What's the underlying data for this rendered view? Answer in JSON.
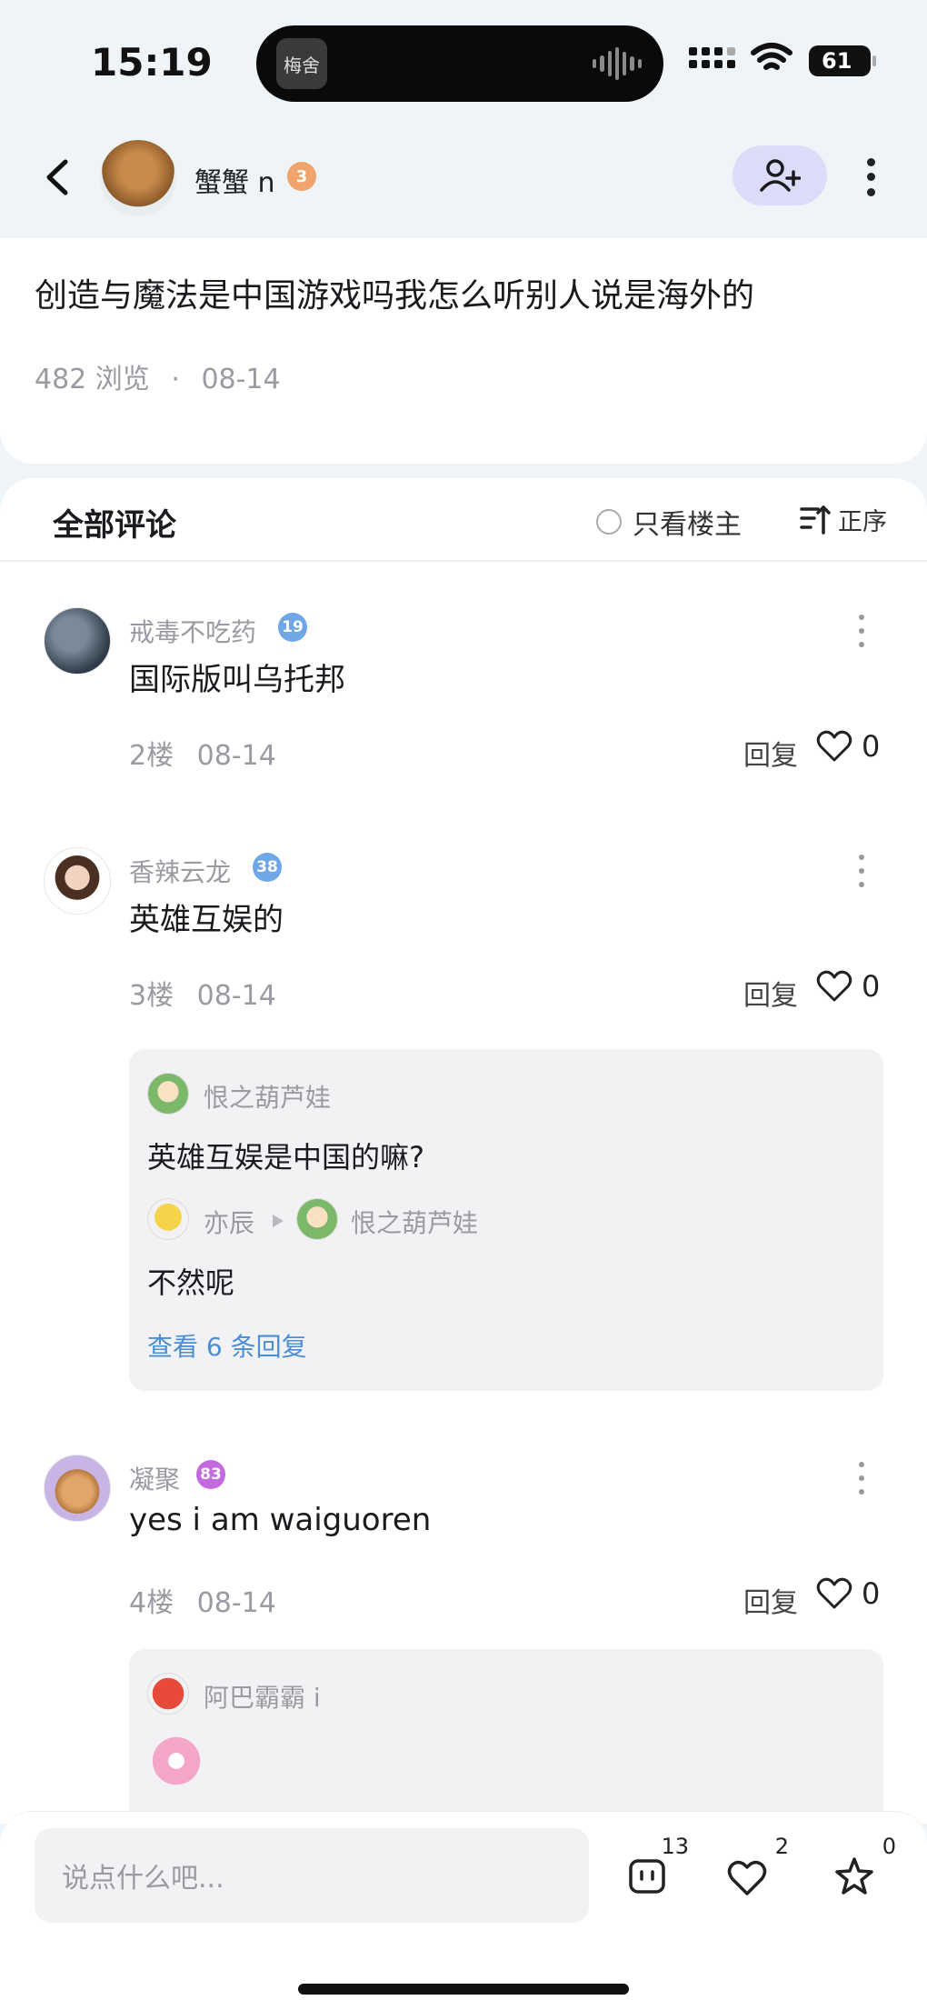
{
  "status_bar": {
    "time": "15:19",
    "island_app_text": "梅舍",
    "battery": "61"
  },
  "topnav": {
    "author_name": "蟹蟹 n",
    "author_level": "3"
  },
  "post": {
    "title": "创造与魔法是中国游戏吗我怎么听别人说是海外的",
    "views": "482 浏览",
    "date": "08-14"
  },
  "comments_header": {
    "title": "全部评论",
    "only_owner": "只看楼主",
    "sort": "正序"
  },
  "comments": [
    {
      "name": "戒毒不吃药",
      "level": "19",
      "text": "国际版叫乌托邦",
      "floor": "2楼",
      "date": "08-14",
      "reply_label": "回复",
      "likes": "0"
    },
    {
      "name": "香辣云龙",
      "level": "38",
      "text": "英雄互娱的",
      "floor": "3楼",
      "date": "08-14",
      "reply_label": "回复",
      "likes": "0",
      "replies": [
        {
          "name": "恨之葫芦娃",
          "text": "英雄互娱是中国的嘛?"
        },
        {
          "name": "亦辰",
          "to": "恨之葫芦娃",
          "text": "不然呢"
        }
      ],
      "view_more": "查看 6 条回复"
    },
    {
      "name": "凝聚",
      "level": "83",
      "text": "yes i am waiguoren",
      "floor": "4楼",
      "date": "08-14",
      "reply_label": "回复",
      "likes": "0",
      "replies": [
        {
          "name": "阿巴霸霸 i"
        }
      ]
    }
  ],
  "bottom_bar": {
    "input_placeholder": "说点什么吧...",
    "comment_count": "13",
    "like_count": "2",
    "star_count": "0"
  },
  "colors": {
    "background": "#eef4f8",
    "follow_button": "#dcdcf8",
    "link_blue": "#4a8fd6",
    "muted_text": "#9a9aa2"
  },
  "icons": [
    "back-arrow-icon",
    "add-friend-icon",
    "more-vertical-icon",
    "radio-icon",
    "sort-icon",
    "heart-icon",
    "comment-icon",
    "star-icon"
  ]
}
